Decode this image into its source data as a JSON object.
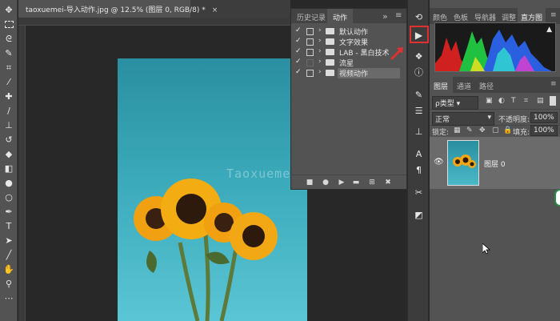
{
  "document": {
    "title": "taoxuemei-导入动作.jpg @ 12.5% (图层 0, RGB/8) *",
    "close": "×"
  },
  "watermark": "Taoxuemei.com",
  "toolbar": {
    "tools": [
      "move-tool",
      "marquee-tool",
      "lasso-tool",
      "quick-select-tool",
      "crop-tool",
      "eyedropper-tool",
      "healing-tool",
      "brush-tool",
      "clone-stamp-tool",
      "history-brush-tool",
      "eraser-tool",
      "gradient-tool",
      "blur-tool",
      "dodge-tool",
      "pen-tool",
      "type-tool",
      "path-select-tool",
      "line-tool",
      "hand-tool",
      "zoom-tool"
    ]
  },
  "actions_panel": {
    "tabs": [
      "历史记录",
      "动作"
    ],
    "expand": "»",
    "items": [
      {
        "label": "默认动作",
        "checked": true,
        "dialog": true,
        "selected": false
      },
      {
        "label": "文字效果",
        "checked": true,
        "dialog": true,
        "selected": false
      },
      {
        "label": "LAB - 黑白技术",
        "checked": true,
        "dialog": true,
        "selected": false
      },
      {
        "label": "流星",
        "checked": true,
        "dialog": false,
        "selected": false
      },
      {
        "label": "视频动作",
        "checked": true,
        "dialog": true,
        "selected": true
      }
    ],
    "check": "✓",
    "arrow": "›",
    "footer_icons": [
      "stop-icon",
      "record-icon",
      "play-icon",
      "new-set-icon",
      "new-action-icon",
      "delete-icon"
    ]
  },
  "icon_strip": {
    "play": "▶"
  },
  "top_panel": {
    "tabs": [
      "颜色",
      "色板",
      "导航器",
      "调整",
      "直方图"
    ],
    "warning": "▲"
  },
  "layers_panel": {
    "tabs": [
      "图层",
      "通道",
      "路径"
    ],
    "filter_kind": "ρ类型",
    "blend_mode": "正常",
    "opacity_label": "不透明度:",
    "opacity_value": "100%",
    "lock_label": "锁定:",
    "fill_label": "填充:",
    "fill_value": "100%",
    "layer_name": "图层 0"
  },
  "colors": {
    "highlight": "#e03030",
    "panel": "#535353"
  }
}
